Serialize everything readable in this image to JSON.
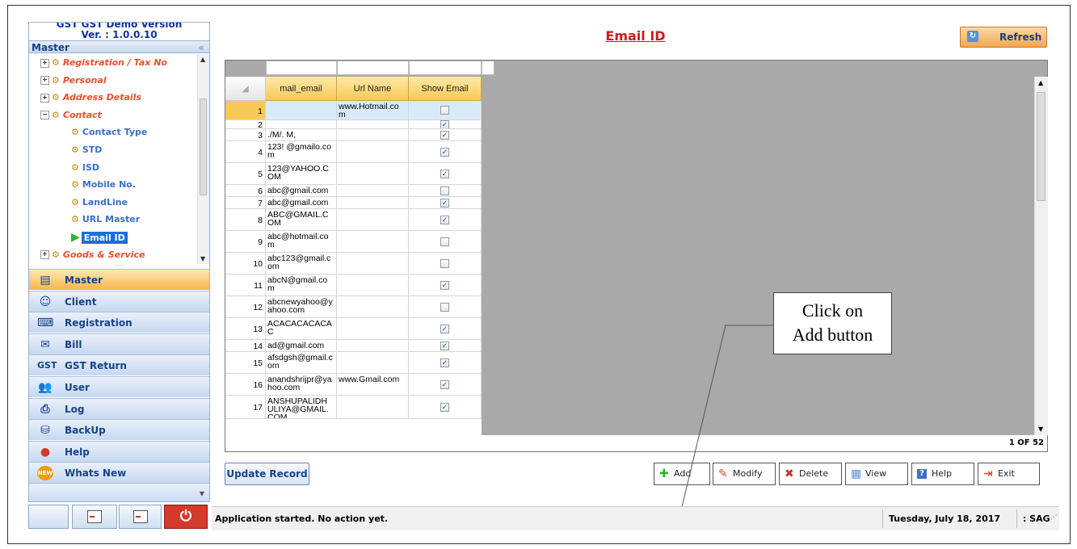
{
  "app": {
    "version_top": "GST GST Demo Version",
    "version": "Ver. : 1.0.0.10"
  },
  "sidebar": {
    "header": "Master",
    "collapse_glyph": "«",
    "tree": [
      {
        "label": "Registration / Tax No",
        "type": "group",
        "expanded": false
      },
      {
        "label": "Personal",
        "type": "group",
        "expanded": false
      },
      {
        "label": "Address Details",
        "type": "group",
        "expanded": false
      },
      {
        "label": "Contact",
        "type": "group",
        "expanded": true
      },
      {
        "label": "Contact Type",
        "type": "child"
      },
      {
        "label": "STD",
        "type": "child"
      },
      {
        "label": "ISD",
        "type": "child"
      },
      {
        "label": "Mobile No.",
        "type": "child"
      },
      {
        "label": "LandLine",
        "type": "child"
      },
      {
        "label": "URL Master",
        "type": "child"
      },
      {
        "label": "Email ID",
        "type": "child",
        "selected": true
      },
      {
        "label": "Goods & Service",
        "type": "group",
        "expanded": false
      }
    ],
    "nav": [
      {
        "label": "Master",
        "icon": "master-icon",
        "active": true
      },
      {
        "label": "Client",
        "icon": "client-icon"
      },
      {
        "label": "Registration",
        "icon": "registration-icon"
      },
      {
        "label": "Bill",
        "icon": "bill-icon"
      },
      {
        "label": "GST Return",
        "icon": "gst-icon"
      },
      {
        "label": "User",
        "icon": "user-icon"
      },
      {
        "label": "Log",
        "icon": "log-icon"
      },
      {
        "label": "BackUp",
        "icon": "backup-icon"
      },
      {
        "label": "Help",
        "icon": "help-icon"
      },
      {
        "label": "Whats New",
        "icon": "new-icon"
      }
    ],
    "gst_glyph": "GST",
    "new_glyph": "NEW"
  },
  "main": {
    "title": "Email ID",
    "refresh_label": "Refresh",
    "columns": [
      "mail_email",
      "Url Name",
      "Show Email"
    ],
    "rows": [
      {
        "n": "1",
        "email": "",
        "url": "www.Hotmail.co m",
        "show": false,
        "selected": true
      },
      {
        "n": "2",
        "email": "",
        "url": "",
        "show": true
      },
      {
        "n": "3",
        "email": "./M/. M,",
        "url": "",
        "show": true
      },
      {
        "n": "4",
        "email": "123! @gmailo.com",
        "url": "",
        "show": true
      },
      {
        "n": "5",
        "email": "123@YAHOO.C OM",
        "url": "",
        "show": true
      },
      {
        "n": "6",
        "email": "abc@gmail.com",
        "url": "",
        "show": false
      },
      {
        "n": "7",
        "email": "abc@gmail.com",
        "url": "",
        "show": true
      },
      {
        "n": "8",
        "email": "ABC@GMAIL.C OM",
        "url": "",
        "show": true
      },
      {
        "n": "9",
        "email": "abc@hotmail.co m",
        "url": "",
        "show": false
      },
      {
        "n": "10",
        "email": "abc123@gmail.c om",
        "url": "",
        "show": false
      },
      {
        "n": "11",
        "email": "abcN@gmail.co m",
        "url": "",
        "show": true
      },
      {
        "n": "12",
        "email": "abcnewyahoo@y ahoo.com",
        "url": "",
        "show": false
      },
      {
        "n": "13",
        "email": "ACACACACACA C",
        "url": "",
        "show": true
      },
      {
        "n": "14",
        "email": "ad@gmail.com",
        "url": "",
        "show": true
      },
      {
        "n": "15",
        "email": "afsdgsh@gmail.c om",
        "url": "",
        "show": true
      },
      {
        "n": "16",
        "email": "anandshrijpr@ya hoo.com",
        "url": "www.Gmail.com",
        "show": true
      },
      {
        "n": "17",
        "email": "ANSHUPALIDH ULIYA@GMAIL. COM",
        "url": "",
        "show": true
      }
    ],
    "pager": "1 OF 52",
    "update_label": "Update Record",
    "buttons": [
      {
        "label": "Add",
        "icon": "add-icon"
      },
      {
        "label": "Modify",
        "icon": "modify-icon"
      },
      {
        "label": "Delete",
        "icon": "delete-icon"
      },
      {
        "label": "View",
        "icon": "view-icon"
      },
      {
        "label": "Help",
        "icon": "help-icon"
      },
      {
        "label": "Exit",
        "icon": "exit-icon"
      }
    ],
    "callout": [
      "Click on",
      "Add button"
    ]
  },
  "status": {
    "message": "Application started. No action yet.",
    "date": "Tuesday, July 18, 2017",
    "user": ": SAG"
  },
  "colors": {
    "title": "#d11a1a",
    "accent": "#f7c957",
    "nav_text": "#15428b"
  }
}
